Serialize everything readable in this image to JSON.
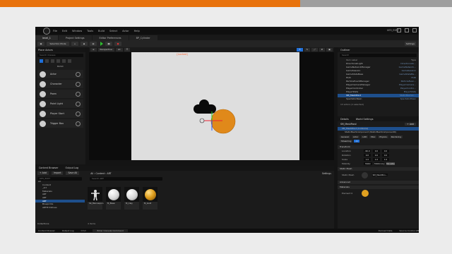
{
  "window": {
    "title": "UE5_EXP7"
  },
  "menu": [
    "File",
    "Edit",
    "Window",
    "Tools",
    "Build",
    "Select",
    "Actor",
    "Help"
  ],
  "tabs": [
    "level_1",
    "Project Settings",
    "Editor Preferences",
    "BP_Cylinder"
  ],
  "toolbar": {
    "mode": "Selection Mode",
    "settings": "Settings"
  },
  "place_actors": {
    "title": "Place Actors",
    "search_placeholder": "Search Classes",
    "section": "BASIC",
    "items": [
      "Actor",
      "Character",
      "Pawn",
      "Point Light",
      "Player Start",
      "Trigger Box"
    ]
  },
  "viewport": {
    "perspective": "Perspective",
    "lit": "Lit",
    "pilot": "[ Pilot Active - CineCameraActor ]",
    "locked": "[Locked]"
  },
  "outliner": {
    "title": "Outliner",
    "search_placeholder": "Search",
    "columns": [
      "Item Label",
      "Type"
    ],
    "items": [
      {
        "label": "DirectionalLight",
        "type": "DirectionalLi..."
      },
      {
        "label": "GameNetworkManager",
        "type": "GameNetwork..."
      },
      {
        "label": "GameSession",
        "type": "GameSession"
      },
      {
        "label": "GameStateBase",
        "type": "GameStateBa..."
      },
      {
        "label": "HUD",
        "type": "HUD"
      },
      {
        "label": "ParticleEventManager",
        "type": "ParticleEven..."
      },
      {
        "label": "PlayerCameraManager",
        "type": "PlayerCamera..."
      },
      {
        "label": "PlayerController",
        "type": "PlayerContro..."
      },
      {
        "label": "PlayerState",
        "type": "PlayerState"
      },
      {
        "label": "SM_MeshPond",
        "type": "StaticMeshAc...",
        "selected": true
      },
      {
        "label": "SpectatorPawn",
        "type": "SpectatorPawn"
      }
    ],
    "footer": "13 actors (1 selected)"
  },
  "details": {
    "tabs": [
      "Details",
      "World Settings"
    ],
    "object": "SM_MeshPond",
    "add_label": "+ Add",
    "instance": "SM_MeshPond (Instance)",
    "component": "StaticMeshComponent (StaticMeshComponent0)",
    "categories": [
      "General",
      "Actor",
      "LOD",
      "Misc",
      "Physics",
      "Rendering",
      "Streaming",
      "All"
    ],
    "transform_title": "Transform",
    "location": {
      "label": "Location",
      "x": "-96.0",
      "y": "0.0",
      "z": "0.0"
    },
    "rotation": {
      "label": "Rotation",
      "x": "0.0",
      "y": "0.0",
      "z": "0.0"
    },
    "scale": {
      "label": "Scale",
      "x": "1.0",
      "y": "1.0",
      "z": "1.0"
    },
    "mobility": {
      "label": "Mobility",
      "options": [
        "Static",
        "Stationary",
        "Movable"
      ]
    },
    "static_mesh_section": "Static Mesh",
    "static_mesh_label": "Static Mesh",
    "static_mesh_value": "SM_MeshPon...",
    "advanced": "Advanced",
    "materials_section": "Materials",
    "element0": "Element 0"
  },
  "content_browser": {
    "tabs": [
      "Content Browser",
      "Output Log"
    ],
    "add": "+ Add",
    "import": "Import",
    "save_all": "Save All",
    "breadcrumb": [
      "All",
      "Content",
      "ART"
    ],
    "settings": "Settings",
    "search_placeholder": "Search ART",
    "tree_root": "UE5_EXP7",
    "tree": [
      "All",
      "Content",
      "_Art",
      "Materials",
      "ART",
      "ART",
      "ART",
      "Blueprints",
      "ARTPrimitives"
    ],
    "selected_tree_index": 6,
    "assets": [
      {
        "label": "SK_Mannequin",
        "kind": "mannequin"
      },
      {
        "label": "M_Base",
        "kind": "white"
      },
      {
        "label": "M_Clay",
        "kind": "white"
      },
      {
        "label": "M_Gold",
        "kind": "gold"
      }
    ],
    "count": "4 items",
    "collections": "Collections"
  },
  "status": {
    "drawer": "Content Drawer",
    "output": "Output Log",
    "cmd": "Cmd",
    "console_placeholder": "Enter Console Command",
    "derived": "Derived Data",
    "source": "Source Control Off"
  },
  "colors": {
    "accent_orange": "#e8720c",
    "selection_blue": "#1e4f8c",
    "actor_orange": "#e0891a"
  }
}
